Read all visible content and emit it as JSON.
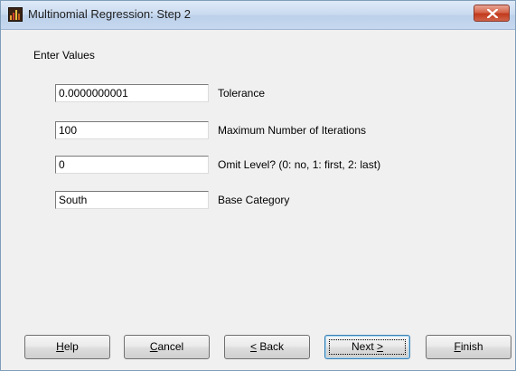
{
  "window": {
    "title": "Multinomial Regression: Step 2",
    "app_icon": "app-logo-icon",
    "close_icon": "close-icon"
  },
  "section": {
    "label": "Enter Values"
  },
  "fields": {
    "tolerance": {
      "value": "0.0000000001",
      "label": "Tolerance"
    },
    "max_iterations": {
      "value": "100",
      "label": "Maximum Number of Iterations"
    },
    "omit_level": {
      "value": "0",
      "label": "Omit Level? (0: no, 1: first, 2: last)"
    },
    "base_category": {
      "value": "South",
      "label": "Base Category"
    }
  },
  "buttons": {
    "help": {
      "mnemonic": "H",
      "rest": "elp"
    },
    "cancel": {
      "mnemonic": "C",
      "rest": "ancel"
    },
    "back": {
      "mnemonic": "<",
      "rest": " Back"
    },
    "next": {
      "pre": "Next ",
      "mnemonic": ">"
    },
    "finish": {
      "mnemonic": "F",
      "rest": "inish"
    }
  },
  "colors": {
    "titlebar": "#c9daf0",
    "close_button": "#c2391b",
    "dialog_background": "#f0f0f0",
    "default_button_border": "#3c7fb1"
  }
}
